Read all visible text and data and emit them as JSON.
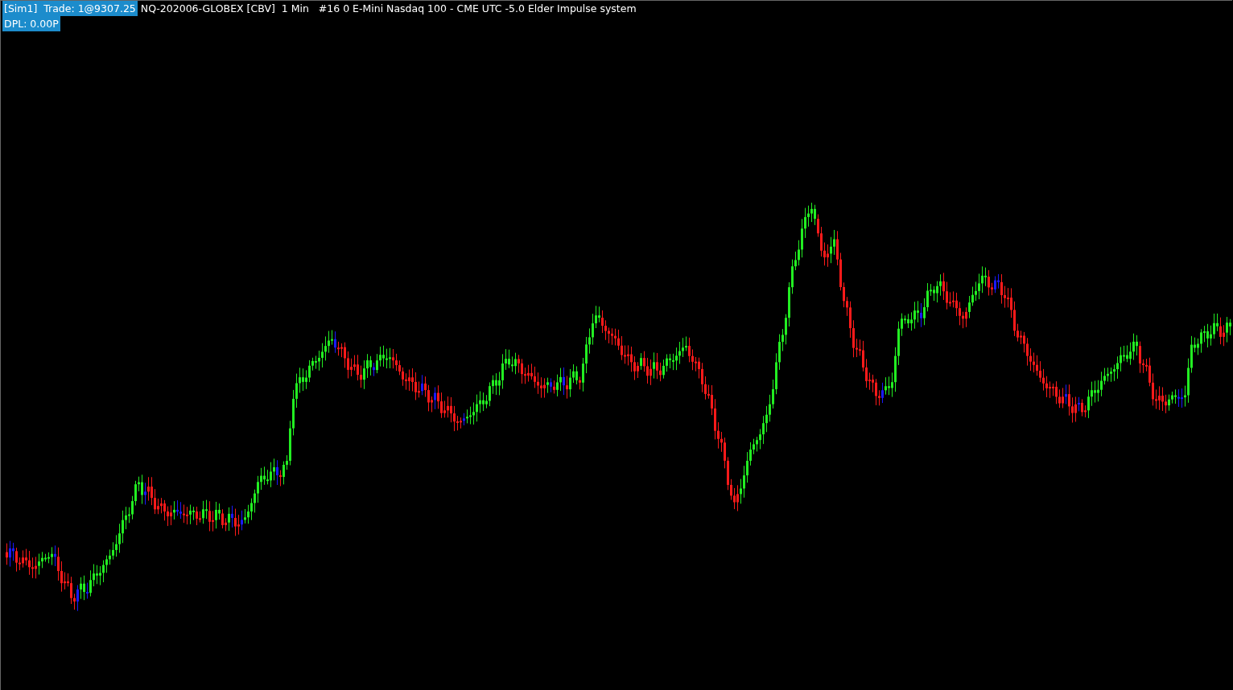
{
  "header": {
    "account": "[Sim1]",
    "trade": "Trade: 1@9307.25",
    "instrument": "NQ-202006-GLOBEX [CBV]",
    "interval": "1 Min",
    "description": "#16 0 E-Mini Nasdaq 100 - CME UTC -5.0 Elder Impulse system"
  },
  "pnl": {
    "label": "DPL: 0.00P"
  }
}
